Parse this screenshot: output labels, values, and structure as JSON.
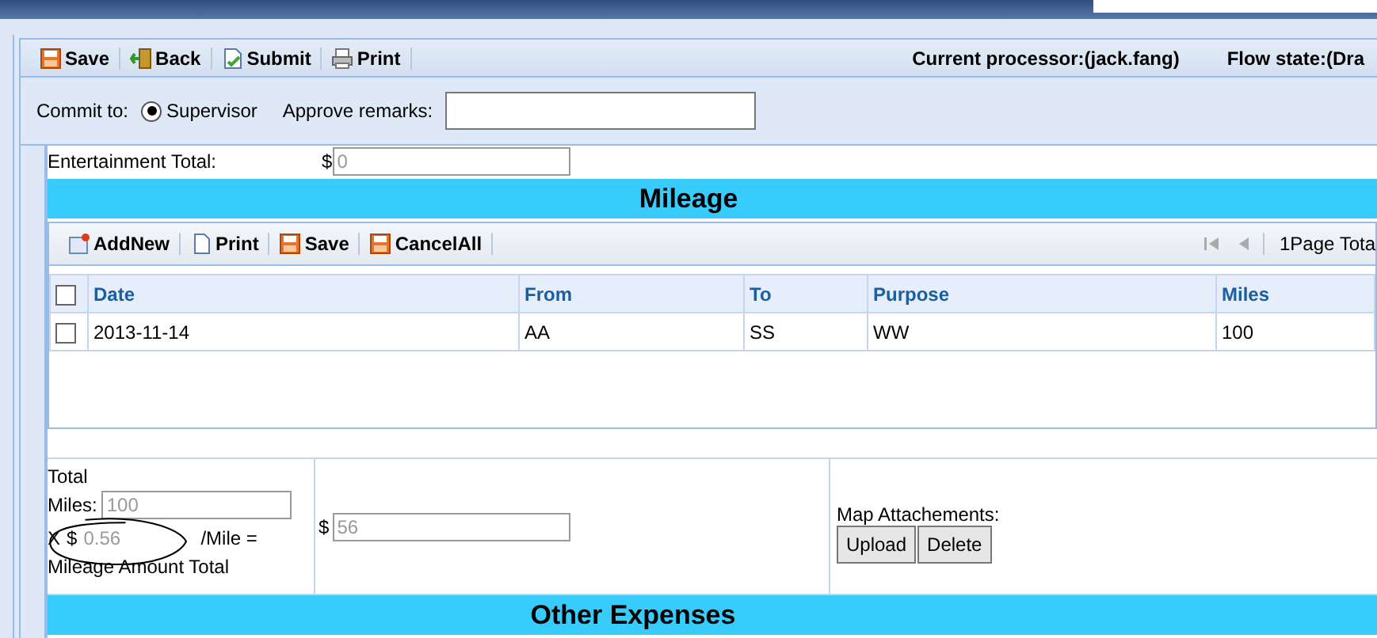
{
  "toolbar": {
    "buttons": [
      {
        "label": "Save",
        "kind": "save"
      },
      {
        "label": "Back",
        "kind": "back"
      },
      {
        "label": "Submit",
        "kind": "submit"
      },
      {
        "label": "Print",
        "kind": "print"
      }
    ],
    "processor": "Current processor:(jack.fang)",
    "flow_state": "Flow state:(Dra"
  },
  "commit": {
    "label": "Commit to:",
    "options": [
      {
        "label": "Supervisor",
        "selected": true
      }
    ],
    "remarks_label": "Approve remarks:"
  },
  "entertainment": {
    "label": "Entertainment Total:",
    "currency": "$",
    "value": "0"
  },
  "mileage": {
    "title": "Mileage",
    "grid_toolbar": {
      "buttons": [
        {
          "label": "AddNew",
          "kind": "add"
        },
        {
          "label": "Print",
          "kind": "doc"
        },
        {
          "label": "Save",
          "kind": "save"
        },
        {
          "label": "CancelAll",
          "kind": "save"
        }
      ],
      "paging": "1Page Tota"
    },
    "select_all_checked": false,
    "columns": [
      "Date",
      "From",
      "To",
      "Purpose",
      "Miles"
    ],
    "rows": [
      {
        "checked": false,
        "cells": [
          "2013-11-14",
          "AA",
          "SS",
          "WW",
          "100"
        ]
      }
    ],
    "total_label": "Total",
    "miles_label": "Miles:",
    "miles_value": "100",
    "times": "X",
    "currency": "$",
    "rate_value": "0.56",
    "per_mile": "/Mile =",
    "amount_label": "Mileage Amount Total",
    "amount_currency": "$",
    "amount_value": "56",
    "attachments_label": "Map Attachements:",
    "attachment_buttons": [
      "Upload",
      "Delete"
    ]
  },
  "other_expenses": {
    "title": "Other Expenses"
  }
}
